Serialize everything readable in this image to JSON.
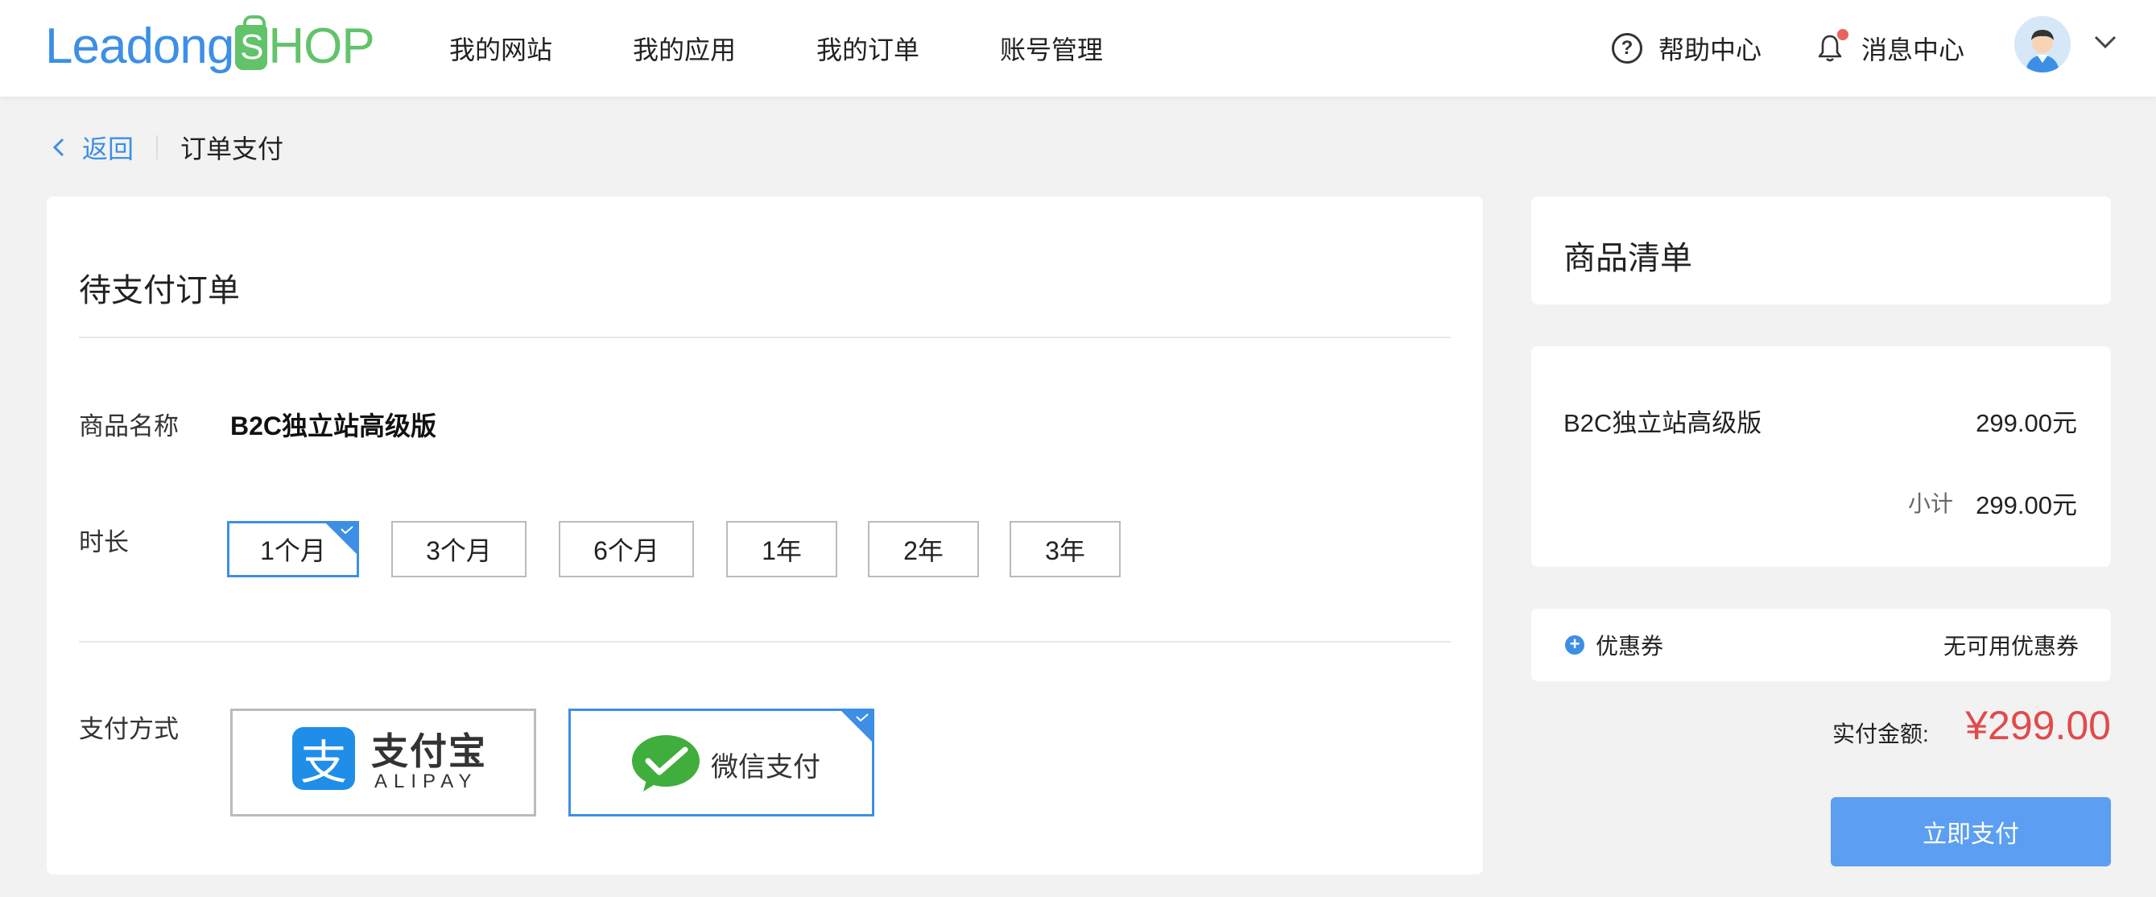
{
  "header": {
    "logo": {
      "part1": "Leadong",
      "bag_letter": "S",
      "part2": "HOP"
    },
    "nav": [
      "我的网站",
      "我的应用",
      "我的订单",
      "账号管理"
    ],
    "help_label": "帮助中心",
    "messages_label": "消息中心"
  },
  "breadcrumb": {
    "back_label": "返回",
    "current": "订单支付"
  },
  "order": {
    "title": "待支付订单",
    "product_label": "商品名称",
    "product_name": "B2C独立站高级版",
    "duration_label": "时长",
    "durations": [
      "1个月",
      "3个月",
      "6个月",
      "1年",
      "2年",
      "3年"
    ],
    "selected_duration": "1个月",
    "payment_label": "支付方式",
    "payment_methods": {
      "alipay": {
        "glyph": "支",
        "name": "支付宝",
        "sub": "ALIPAY"
      },
      "wechat": {
        "name": "微信支付"
      }
    },
    "selected_payment": "微信支付"
  },
  "summary": {
    "title": "商品清单",
    "item_name": "B2C独立站高级版",
    "item_price": "299.00元",
    "subtotal_label": "小计",
    "subtotal_value": "299.00元",
    "coupon_label": "优惠券",
    "coupon_status": "无可用优惠券",
    "paid_label": "实付金额:",
    "paid_amount": "¥299.00",
    "pay_button": "立即支付"
  },
  "colors": {
    "accent": "#3d8fe6",
    "brand_green": "#62c36a",
    "price_red": "#e24a4a",
    "button_blue": "#5b9ef2",
    "notification_dot": "#e8645a"
  }
}
